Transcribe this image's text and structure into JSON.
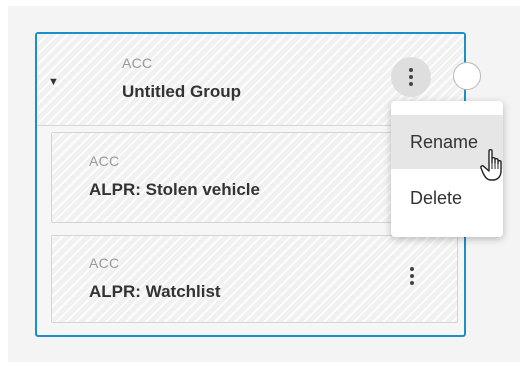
{
  "group": {
    "type_label": "ACC",
    "title": "Untitled Group",
    "expanded": true
  },
  "items": [
    {
      "type_label": "ACC",
      "title": "ALPR: Stolen vehicle"
    },
    {
      "type_label": "ACC",
      "title": "ALPR: Watchlist"
    }
  ],
  "context_menu": {
    "items": [
      {
        "label": "Rename",
        "hovered": true
      },
      {
        "label": "Delete",
        "hovered": false
      }
    ]
  },
  "icons": {
    "caret": "caret-down-icon",
    "kebab": "kebab-menu-icon",
    "cursor": "hand-pointer-cursor-icon",
    "checkbox": "radio-circle-icon"
  },
  "colors": {
    "accent_border": "#1a8fc9",
    "hatch_base": "#f1f1f1",
    "text_primary": "#333333",
    "text_secondary": "#9a9a9a"
  }
}
